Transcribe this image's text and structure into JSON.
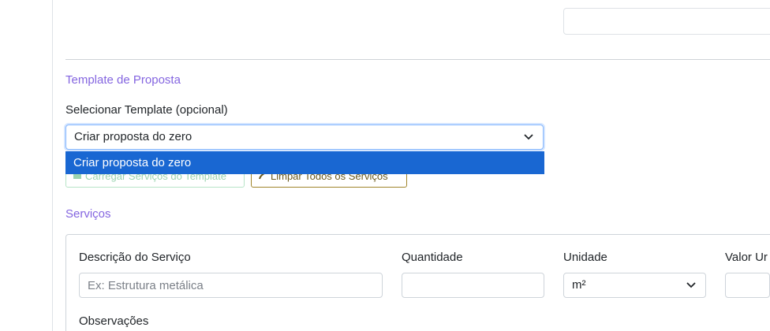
{
  "section_template": {
    "title": "Template de Proposta"
  },
  "template_select": {
    "label": "Selecionar Template (opcional)",
    "selected": "Criar proposta do zero",
    "options": [
      "Criar proposta do zero"
    ]
  },
  "template_buttons": {
    "load_label": "Carregar Serviços do Template",
    "clear_label": "Limpar Todos os Serviços"
  },
  "section_services": {
    "title": "Serviços"
  },
  "service_form": {
    "description_label": "Descrição do Serviço",
    "description_placeholder": "Ex: Estrutura metálica",
    "quantity_label": "Quantidade",
    "unit_label": "Unidade",
    "unit_value": "m²",
    "value_label": "Valor Ur",
    "observations_label": "Observações"
  },
  "colors": {
    "section_title": "#8465e0",
    "dropdown_highlight": "#1967d2",
    "load_button_border": "#b7e4c7",
    "clear_button_border": "#a0852b"
  },
  "icons": {
    "load": "upload-icon",
    "clear": "broom-icon",
    "select": "chevron-down-icon"
  }
}
